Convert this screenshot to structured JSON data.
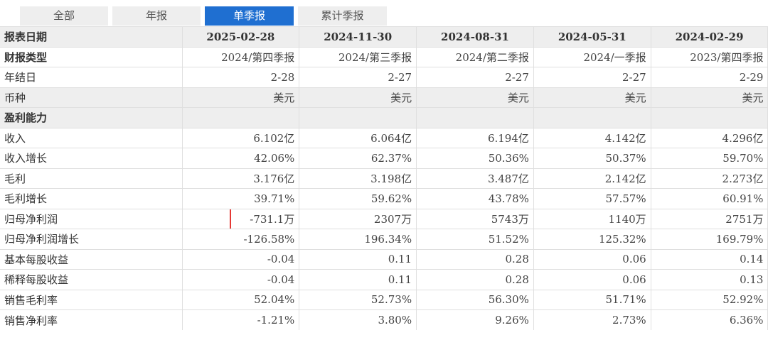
{
  "tabs": [
    {
      "label": "全部",
      "active": false
    },
    {
      "label": "年报",
      "active": false
    },
    {
      "label": "单季报",
      "active": true
    },
    {
      "label": "累计季报",
      "active": false
    }
  ],
  "table": {
    "header": {
      "label": "报表日期",
      "dates": [
        "2025-02-28",
        "2024-11-30",
        "2024-08-31",
        "2024-05-31",
        "2024-02-29"
      ]
    },
    "meta_rows": [
      {
        "label": "财报类型",
        "values": [
          "2024/第四季报",
          "2024/第三季报",
          "2024/第二季报",
          "2024/一季报",
          "2023/第四季报"
        ],
        "style": "bold"
      },
      {
        "label": "年结日",
        "values": [
          "2-28",
          "2-27",
          "2-27",
          "2-27",
          "2-29"
        ],
        "style": "plain"
      },
      {
        "label": "币种",
        "values": [
          "美元",
          "美元",
          "美元",
          "美元",
          "美元"
        ],
        "style": "gray"
      }
    ],
    "section_title": "盈利能力",
    "rows": [
      {
        "label": "收入",
        "values": [
          "6.102亿",
          "6.064亿",
          "6.194亿",
          "4.142亿",
          "4.296亿"
        ]
      },
      {
        "label": "收入增长",
        "values": [
          "42.06%",
          "62.37%",
          "50.36%",
          "50.37%",
          "59.70%"
        ]
      },
      {
        "label": "毛利",
        "values": [
          "3.176亿",
          "3.198亿",
          "3.487亿",
          "2.142亿",
          "2.273亿"
        ]
      },
      {
        "label": "毛利增长",
        "values": [
          "39.71%",
          "59.62%",
          "43.78%",
          "57.57%",
          "60.91%"
        ]
      },
      {
        "label": "归母净利润",
        "values": [
          "-731.1万",
          "2307万",
          "5743万",
          "1140万",
          "2751万"
        ],
        "highlight_index": 0
      },
      {
        "label": "归母净利润增长",
        "values": [
          "-126.58%",
          "196.34%",
          "51.52%",
          "125.32%",
          "169.79%"
        ]
      },
      {
        "label": "基本每股收益",
        "values": [
          "-0.04",
          "0.11",
          "0.28",
          "0.06",
          "0.14"
        ]
      },
      {
        "label": "稀释每股收益",
        "values": [
          "-0.04",
          "0.11",
          "0.28",
          "0.06",
          "0.13"
        ]
      },
      {
        "label": "销售毛利率",
        "values": [
          "52.04%",
          "52.73%",
          "56.30%",
          "51.71%",
          "52.92%"
        ]
      },
      {
        "label": "销售净利率",
        "values": [
          "-1.21%",
          "3.80%",
          "9.26%",
          "2.73%",
          "6.36%"
        ]
      }
    ]
  },
  "colors": {
    "tab_active_bg": "#1f6fd1",
    "tab_inactive_bg": "#eeeeee",
    "header_bg": "#eeeeee",
    "highlight_border": "#e53935"
  }
}
